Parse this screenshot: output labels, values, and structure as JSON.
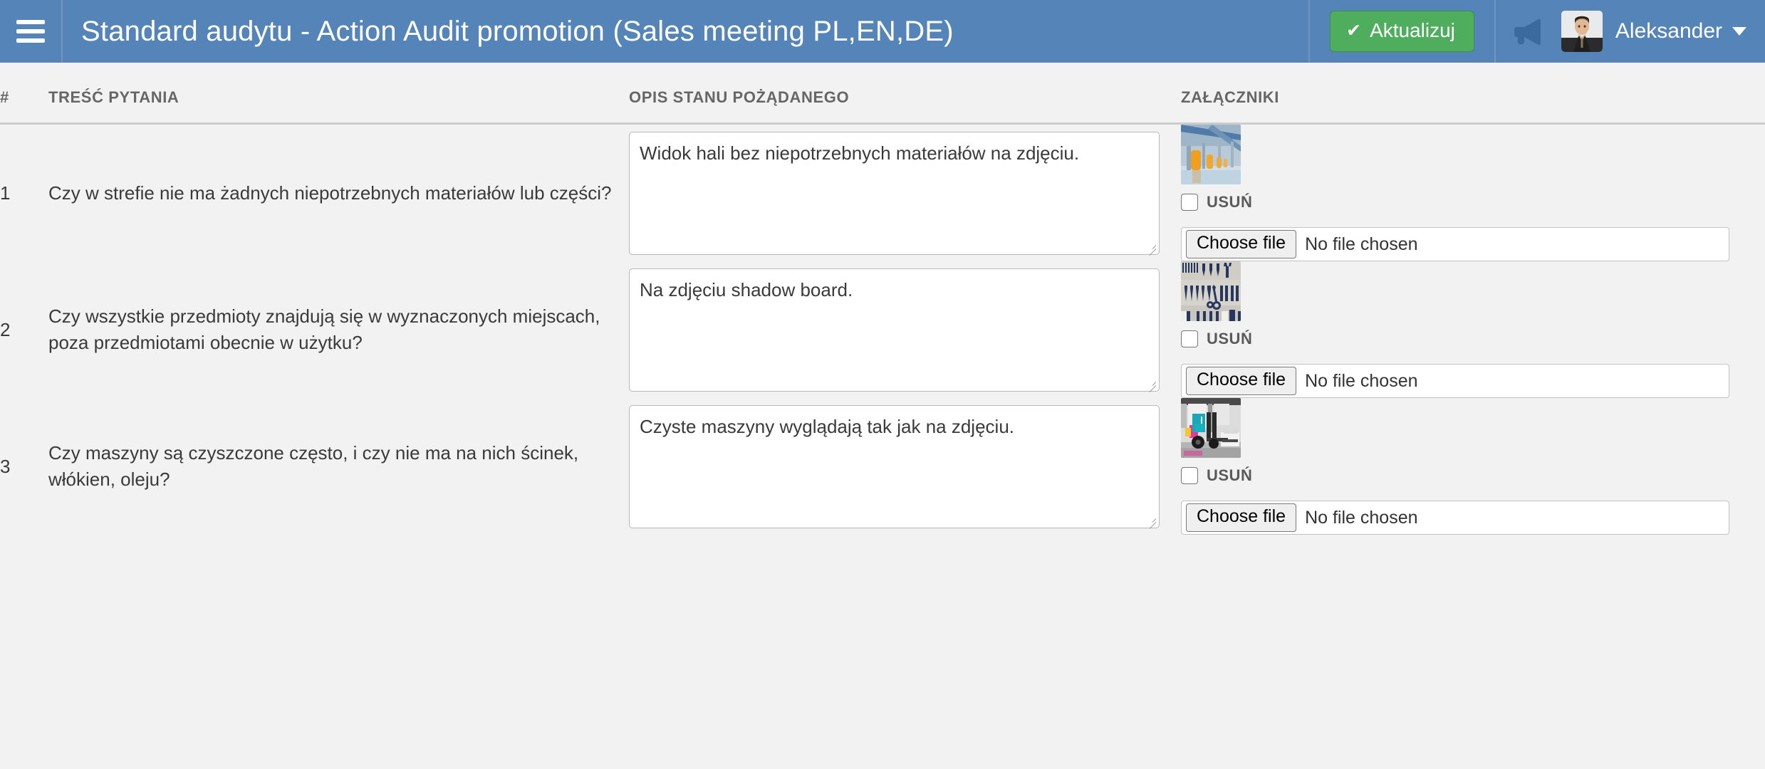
{
  "header": {
    "menu_icon": "hamburger-icon",
    "title": "Standard audytu - Action Audit promotion (Sales meeting PL,EN,DE)",
    "update_button": "Aktualizuj",
    "update_icon": "check-icon",
    "announce_icon": "megaphone-icon",
    "user_name": "Aleksander",
    "caret_icon": "caret-down-icon",
    "bg_color": "#5584b8",
    "button_color": "#4fad5e"
  },
  "table": {
    "columns": {
      "num": "#",
      "question": "TREŚĆ PYTANIA",
      "description": "OPIS STANU POŻĄDANEGO",
      "attachments": "ZAŁĄCZNIKI"
    },
    "file_button_label": "Choose file",
    "file_status_label": "No file chosen",
    "delete_label": "USUŃ",
    "rows": [
      {
        "num": "1",
        "question": "Czy w strefie nie ma żadnych niepotrzebnych materiałów lub części?",
        "description": "Widok hali bez niepotrzebnych materiałów na zdjęciu.",
        "thumbnail": "industrial-hall-photo",
        "delete_label": "USUŃ",
        "file_button_label": "Choose file",
        "file_status_label": "No file chosen"
      },
      {
        "num": "2",
        "question": "Czy wszystkie przedmioty znajdują się w wyznaczonych miejscach, poza przedmiotami obecnie w użytku?",
        "description": "Na zdjęciu shadow board.",
        "thumbnail": "shadow-board-photo",
        "delete_label": "USUŃ",
        "file_button_label": "Choose file",
        "file_status_label": "No file chosen"
      },
      {
        "num": "3",
        "question": "Czy maszyny są czyszczone często, i czy nie ma na nich ścinek, włókien, oleju?",
        "description": "Czyste maszyny wyglądają tak jak na zdjęciu.",
        "thumbnail": "forklift-photo",
        "delete_label": "USUŃ",
        "file_button_label": "Choose file",
        "file_status_label": "No file chosen"
      }
    ]
  }
}
